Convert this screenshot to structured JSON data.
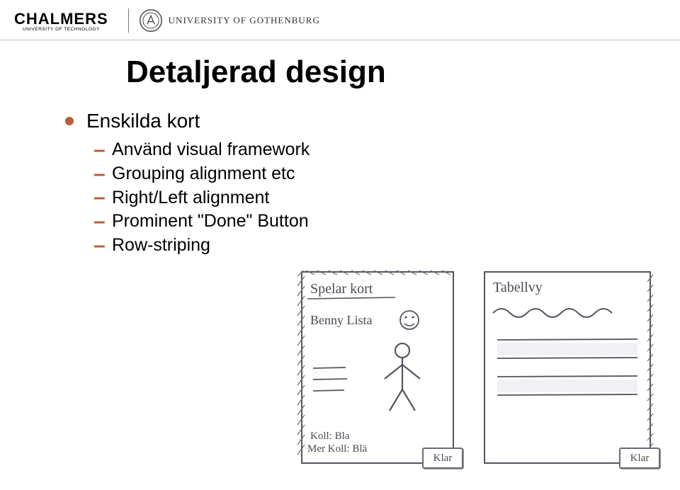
{
  "header": {
    "chalmers_word": "CHALMERS",
    "chalmers_sub": "UNIVERSITY OF TECHNOLOGY",
    "gu_text": "UNIVERSITY OF GOTHENBURG"
  },
  "title": "Detaljerad design",
  "bullet": "Enskilda kort",
  "dashes": [
    "Använd visual framework",
    "Grouping alignment etc",
    "Right/Left alignment",
    "Prominent \"Done\" Button",
    "Row-striping"
  ],
  "sketch_left": {
    "heading": "Spelar kort",
    "name": "Benny Lista",
    "meta1": "Koll: Bla",
    "meta2": "Mer Koll: Blä",
    "done": "Klar"
  },
  "sketch_right": {
    "heading": "Tabellvy",
    "done": "Klar"
  }
}
